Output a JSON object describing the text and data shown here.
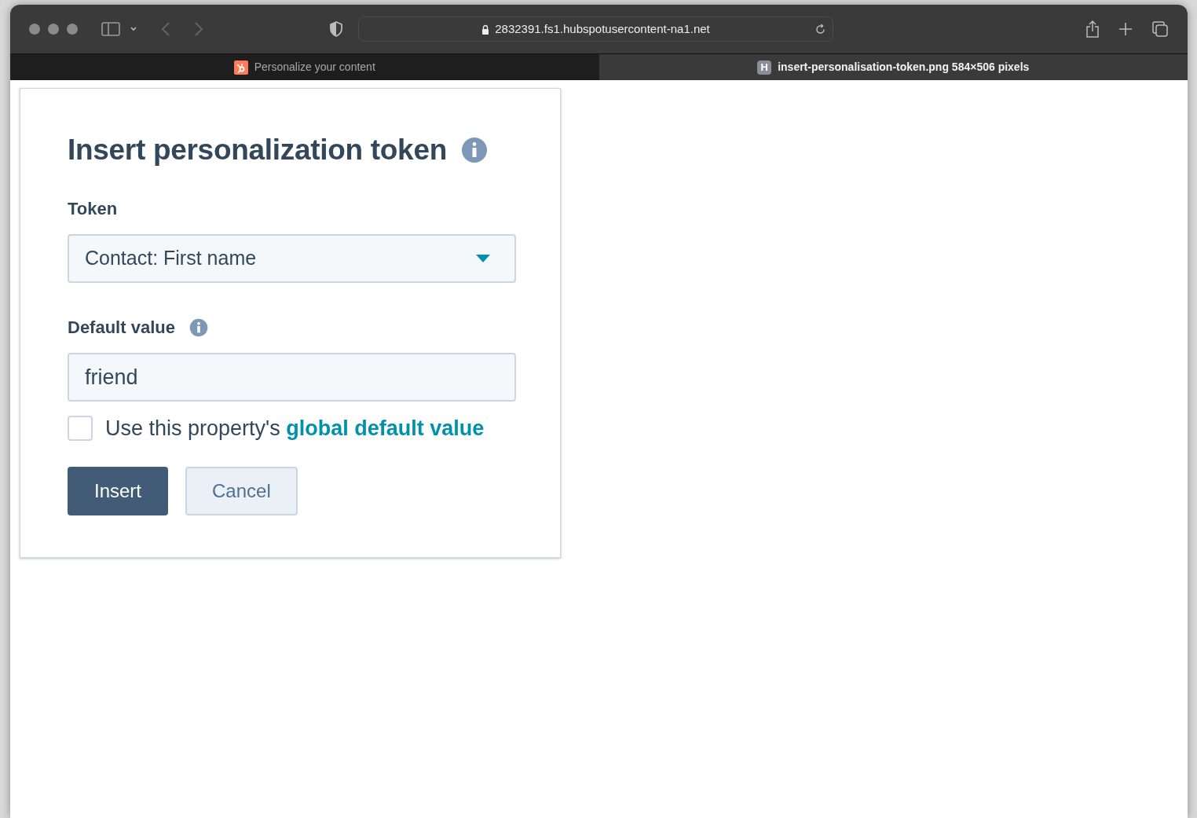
{
  "browser": {
    "address": "2832391.fs1.hubspotusercontent-na1.net"
  },
  "tabs": [
    {
      "label": "Personalize your content",
      "kind": "hubspot",
      "selected": false
    },
    {
      "label": "insert-personalisation-token.png 584×506 pixels",
      "kind": "letter",
      "favicon_letter": "H",
      "selected": true
    }
  ],
  "dialog": {
    "title": "Insert personalization token",
    "token_label": "Token",
    "token_value": "Contact: First name",
    "default_label": "Default value",
    "default_value": "friend",
    "checkbox": {
      "text": "Use this property's ",
      "link": "global default value",
      "checked": false
    },
    "buttons": [
      {
        "label": "Insert",
        "kind": "primary"
      },
      {
        "label": "Cancel",
        "kind": "secondary"
      }
    ]
  }
}
